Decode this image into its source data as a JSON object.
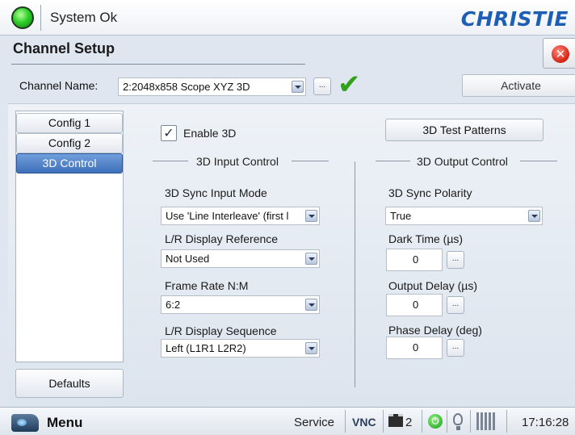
{
  "status": {
    "text": "System Ok",
    "led_color": "#2fd12b"
  },
  "brand": {
    "logo_text": "CHRISTIE",
    "color": "#1f5fb3"
  },
  "page": {
    "title": "Channel Setup"
  },
  "channel": {
    "label": "Channel Name:",
    "value": "2:2048x858 Scope XYZ 3D",
    "browse_label": "...",
    "activate_label": "Activate"
  },
  "tabs": [
    {
      "label": "Config 1",
      "active": false
    },
    {
      "label": "Config 2",
      "active": false
    },
    {
      "label": "3D Control",
      "active": true
    }
  ],
  "defaults_label": "Defaults",
  "enable3d": {
    "label": "Enable 3D",
    "checked": true,
    "check_glyph": "✓"
  },
  "input_control": {
    "title": "3D Input Control",
    "fields": [
      {
        "label": "3D Sync Input Mode",
        "value": "Use 'Line Interleave' (first l"
      },
      {
        "label": "L/R Display Reference",
        "value": "Not Used"
      },
      {
        "label": "Frame Rate N:M",
        "value": "6:2"
      },
      {
        "label": "L/R Display Sequence",
        "value": "Left (L1R1 L2R2)"
      }
    ]
  },
  "output_control": {
    "test_patterns_label": "3D Test Patterns",
    "title": "3D Output Control",
    "sync_polarity": {
      "label": "3D Sync Polarity",
      "value": "True"
    },
    "dark_time": {
      "label": "Dark Time (µs)",
      "value": "0"
    },
    "output_delay": {
      "label": "Output Delay (µs)",
      "value": "0"
    },
    "phase_delay": {
      "label": "Phase Delay (deg)",
      "value": "0"
    },
    "browse_label": "..."
  },
  "taskbar": {
    "menu_label": "Menu",
    "service_label": "Service",
    "vnc_label": "VNC",
    "channel_count": "2",
    "time": "17:16:28"
  }
}
